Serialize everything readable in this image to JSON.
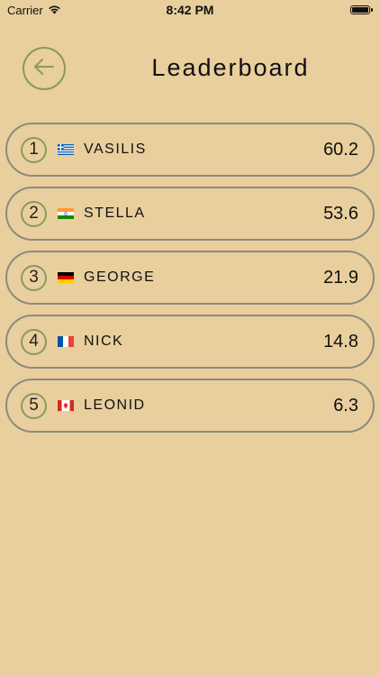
{
  "status": {
    "carrier": "Carrier",
    "time": "8:42 PM"
  },
  "header": {
    "title": "Leaderboard"
  },
  "leaderboard": [
    {
      "rank": "1",
      "name": "VASILIS",
      "country": "greece-flag-icon",
      "score": "60.2"
    },
    {
      "rank": "2",
      "name": "STELLA",
      "country": "india-flag-icon",
      "score": "53.6"
    },
    {
      "rank": "3",
      "name": "GEORGE",
      "country": "germany-flag-icon",
      "score": "21.9"
    },
    {
      "rank": "4",
      "name": "NICK",
      "country": "france-flag-icon",
      "score": "14.8"
    },
    {
      "rank": "5",
      "name": "LEONID",
      "country": "canada-flag-icon",
      "score": "6.3"
    }
  ],
  "colors": {
    "background": "#e9cf9d",
    "accent": "#8a9a5b",
    "row_border": "#8c8a82"
  }
}
